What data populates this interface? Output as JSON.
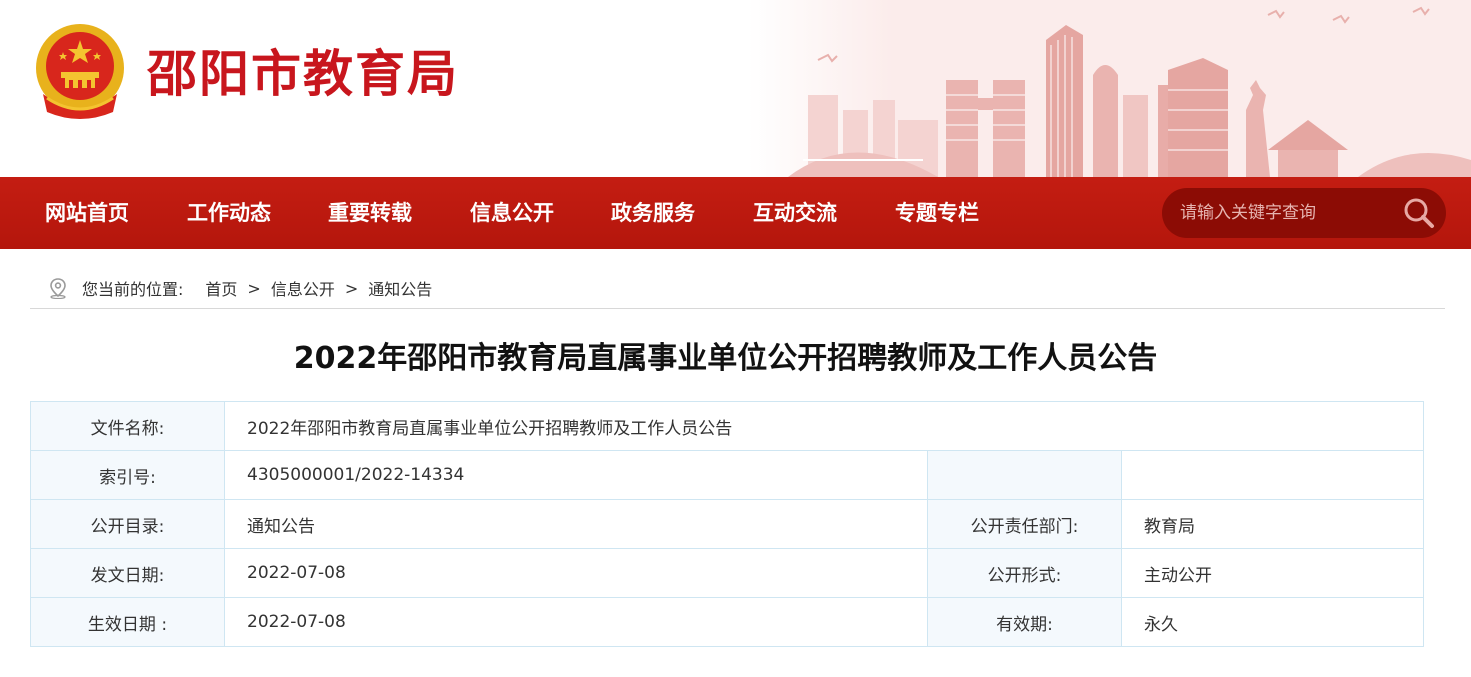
{
  "site": {
    "name": "邵阳市教育局"
  },
  "nav": {
    "items": [
      {
        "label": "网站首页"
      },
      {
        "label": "工作动态"
      },
      {
        "label": "重要转载"
      },
      {
        "label": "信息公开"
      },
      {
        "label": "政务服务"
      },
      {
        "label": "互动交流"
      },
      {
        "label": "专题专栏"
      }
    ],
    "search_placeholder": "请输入关键字查询",
    "search_icon": "magnifier-icon"
  },
  "breadcrumb": {
    "prefix": "您当前的位置:",
    "items": [
      "首页",
      "信息公开",
      "通知公告"
    ],
    "separator": ">"
  },
  "article": {
    "title": "2022年邵阳市教育局直属事业单位公开招聘教师及工作人员公告"
  },
  "info": {
    "file_name_label": "文件名称:",
    "file_name": "2022年邵阳市教育局直属事业单位公开招聘教师及工作人员公告",
    "index_label": "索引号:",
    "index": "4305000001/2022-14334",
    "catalog_label": "公开目录:",
    "catalog": "通知公告",
    "dept_label": "公开责任部门:",
    "dept": "教育局",
    "date_label": "发文日期:",
    "date": "2022-07-08",
    "form_label": "公开形式:",
    "form": "主动公开",
    "effective_label": "生效日期 :",
    "effective": "2022-07-08",
    "validity_label": "有效期:",
    "validity": "永久"
  },
  "colors": {
    "brand_red": "#c8161d",
    "nav_red": "#bc190e",
    "search_bg": "#8c0c05",
    "table_border": "#cfe6f2",
    "label_bg": "#f4f9fd"
  }
}
